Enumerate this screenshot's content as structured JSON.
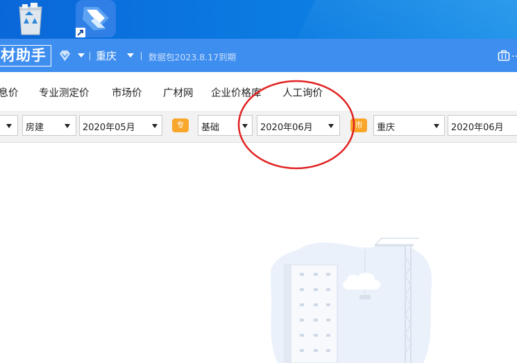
{
  "app": {
    "name": "材助手",
    "region": "重庆",
    "data_pack": "数据包2023.8.17到期",
    "more_label": "…"
  },
  "nav": {
    "items": [
      "信息价",
      "专业测定价",
      "市场价",
      "广材网",
      "企业价格库",
      "人工询价"
    ]
  },
  "filters": {
    "sel_left_partial": "",
    "category": "房建",
    "period_1": "2020年05月",
    "tag_special": "专",
    "specialty": "基础",
    "period_2": "2020年06月",
    "tag_city": "市",
    "city": "重庆",
    "period_3": "2020年06月"
  },
  "colors": {
    "titlebar": "#3e8ef0",
    "tag_orange": "#f8a72b",
    "annotation": "#e12020"
  },
  "icons": {
    "recycle_bin": "recycle-bin-icon",
    "app_shortcut": "app-shortcut-icon",
    "vip": "diamond-icon",
    "briefcase": "briefcase-icon"
  }
}
